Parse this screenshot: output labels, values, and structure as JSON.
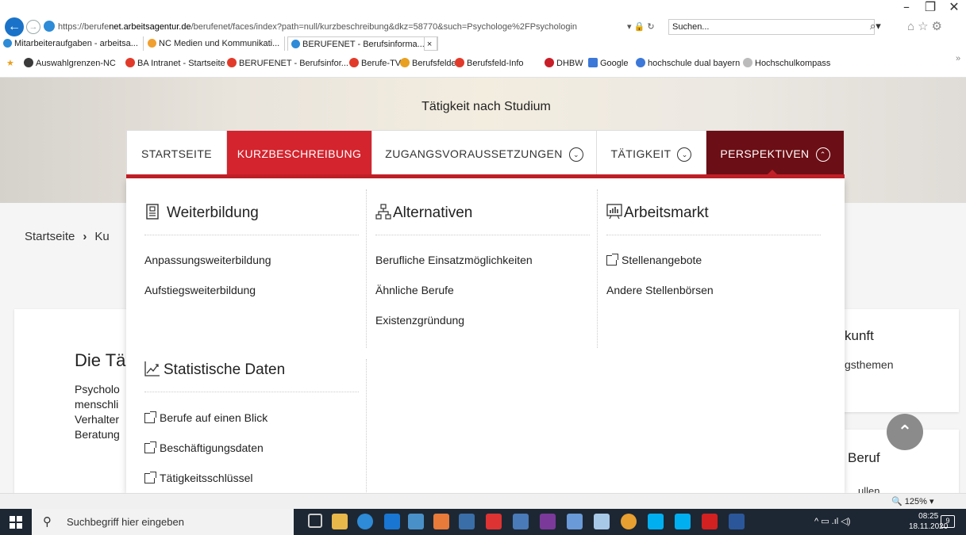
{
  "window": {
    "minimize": "–",
    "maximize": "❐",
    "close": "✕"
  },
  "addressbar": {
    "url_prefix": "https://berufe",
    "url_host": "net.arbeitsagentur.de",
    "url_path": "/berufenet/faces/index?path=null/kurzbeschreibung&dkz=58770&such=Psychologe%2FPsychologin",
    "search_placeholder": "Suchen..."
  },
  "tabs": [
    {
      "label": "Mitarbeiteraufgaben - arbeitsa...",
      "color": "#2d8bd7"
    },
    {
      "label": "NC Medien und Kommunikati...",
      "color": "#f0a030"
    },
    {
      "label": "BERUFENET - Berufsinforma...",
      "color": "#2d8bd7",
      "close": "×"
    }
  ],
  "favorites": [
    {
      "label": "Auswahlgrenzen-NC",
      "color": "#3a3a3a"
    },
    {
      "label": "BA Intranet - Startseite",
      "color": "#e23a2a"
    },
    {
      "label": "BERUFENET - Berufsinfor...",
      "color": "#e23a2a"
    },
    {
      "label": "Berufe-TV",
      "color": "#e23a2a"
    },
    {
      "label": "Berufsfelder",
      "color": "#e8a020"
    },
    {
      "label": "Berufsfeld-Info",
      "color": "#e23a2a"
    },
    {
      "label": "DHBW",
      "color": "#c81e28"
    },
    {
      "label": "Google",
      "color": "#3c78d8"
    },
    {
      "label": "hochschule dual bayern",
      "color": "#3c78d8"
    },
    {
      "label": "Hochschulkompass",
      "color": "#888888"
    }
  ],
  "page": {
    "hero_title": "Tätigkeit nach Studium",
    "breadcrumb_home": "Startseite",
    "breadcrumb_sep": "›",
    "breadcrumb_next": "Ku",
    "card_title": "Die Tä",
    "card_text": [
      "Psycholo",
      "menschli",
      "Verhalter",
      "Beratung"
    ],
    "card_right_title": "kunft",
    "card_right_text": "gsthemen",
    "card_right2_title": "Beruf",
    "card_right2_text": "…ullen"
  },
  "navtabs": [
    {
      "label": "STARTSEITE",
      "chevron": ""
    },
    {
      "label": "KURZBESCHREIBUNG",
      "chevron": ""
    },
    {
      "label": "ZUGANGSVORAUSSETZUNGEN",
      "chevron": "⌄"
    },
    {
      "label": "TÄTIGKEIT",
      "chevron": "⌄"
    },
    {
      "label": "PERSPEKTIVEN",
      "chevron": "⌃"
    }
  ],
  "megamenu": {
    "weiterbildung": {
      "title": "Weiterbildung",
      "links": [
        "Anpassungsweiterbildung",
        "Aufstiegsweiterbildung"
      ]
    },
    "alternativen": {
      "title": "Alternativen",
      "links": [
        "Berufliche Einsatzmöglichkeiten",
        "Ähnliche Berufe",
        "Existenzgründung"
      ]
    },
    "arbeitsmarkt": {
      "title": "Arbeitsmarkt",
      "links": [
        "Stellenangebote",
        "Andere Stellenbörsen"
      ]
    },
    "statistik": {
      "title": "Statistische Daten",
      "links": [
        "Berufe auf einen Blick",
        "Beschäftigungsdaten",
        "Tätigkeitsschlüssel"
      ]
    }
  },
  "statusbar": {
    "zoom": "🔍 125%  ▾"
  },
  "taskbar": {
    "search_placeholder": "Suchbegriff hier eingeben",
    "time": "08:25",
    "date": "18.11.2020",
    "notifications": "9"
  },
  "colors": {
    "brand_red": "#d4242e",
    "brand_dark": "#6c0e15"
  }
}
